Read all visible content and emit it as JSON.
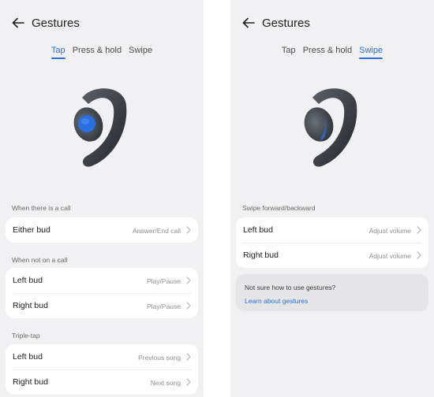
{
  "colors": {
    "accent": "#2a6fe0",
    "background": "#f1f1f3",
    "card": "#ffffff",
    "info_card": "#e6e6e9"
  },
  "left_screen": {
    "title": "Gestures",
    "tabs": [
      {
        "label": "Tap",
        "active": true
      },
      {
        "label": "Press & hold",
        "active": false
      },
      {
        "label": "Swipe",
        "active": false
      }
    ],
    "sections": [
      {
        "label": "When there is a call",
        "rows": [
          {
            "label": "Either bud",
            "value": "Answer/End call"
          }
        ]
      },
      {
        "label": "When not on a call",
        "rows": [
          {
            "label": "Left bud",
            "value": "Play/Pause"
          },
          {
            "label": "Right bud",
            "value": "Play/Pause"
          }
        ]
      },
      {
        "label": "Triple-tap",
        "rows": [
          {
            "label": "Left bud",
            "value": "Previous song"
          },
          {
            "label": "Right bud",
            "value": "Next song"
          }
        ]
      }
    ]
  },
  "right_screen": {
    "title": "Gestures",
    "tabs": [
      {
        "label": "Tap",
        "active": false
      },
      {
        "label": "Press & hold",
        "active": false
      },
      {
        "label": "Swipe",
        "active": true
      }
    ],
    "sections": [
      {
        "label": "Swipe forward/backward",
        "rows": [
          {
            "label": "Left bud",
            "value": "Adjust volume"
          },
          {
            "label": "Right bud",
            "value": "Adjust volume"
          }
        ]
      }
    ],
    "info": {
      "text": "Not sure how to use gestures?",
      "link": "Learn about gestures"
    }
  },
  "icons": {
    "back": "arrow-left-icon",
    "chevron": "chevron-right-icon",
    "earbud": "earbud-illustration"
  }
}
